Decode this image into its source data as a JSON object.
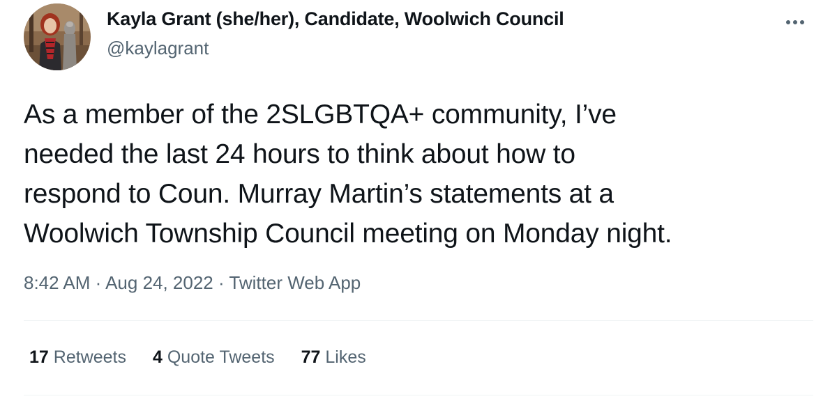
{
  "author": {
    "name": "Kayla Grant (she/her), Candidate, Woolwich Council",
    "handle": "@kaylagrant"
  },
  "tweet": {
    "text": "As a member of the 2SLGBTQA+ community, I’ve\nneeded the last 24 hours to think about how to\nrespond to Coun. Murray Martin’s statements at a\nWoolwich Township Council meeting on Monday night.",
    "time": "8:42 AM",
    "separator": " · ",
    "date": "Aug 24, 2022",
    "source": "Twitter Web App"
  },
  "stats": {
    "retweets_count": "17",
    "retweets_label": "Retweets",
    "quotes_count": "4",
    "quotes_label": "Quote Tweets",
    "likes_count": "77",
    "likes_label": "Likes"
  },
  "icons": {
    "more": "more-options-icon",
    "avatar": "profile-photo"
  },
  "colors": {
    "text_primary": "#0f1419",
    "text_secondary": "#536471",
    "divider": "#eff3f4"
  }
}
